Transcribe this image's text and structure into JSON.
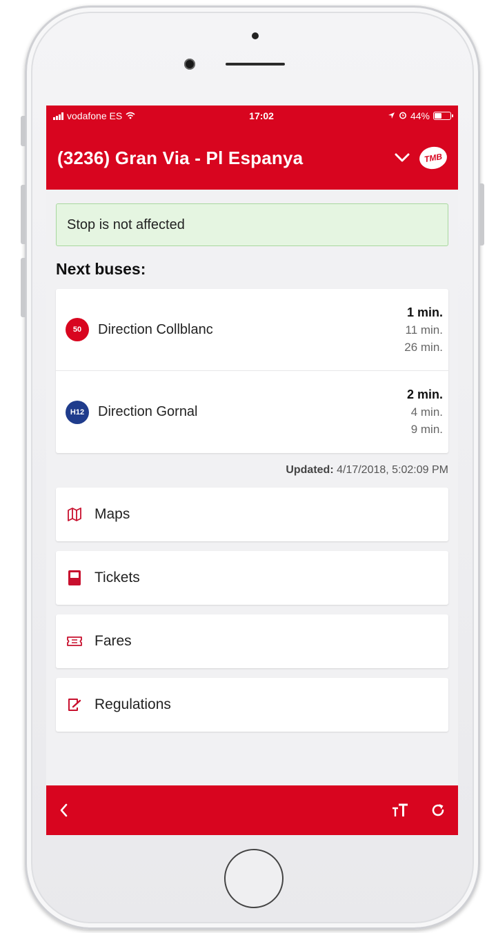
{
  "status_bar": {
    "carrier": "vodafone ES",
    "time": "17:02",
    "battery": "44%",
    "battery_level": 0.44
  },
  "header": {
    "title": "(3236) Gran Via - Pl Espanya",
    "logo_text": "TMB"
  },
  "alert": {
    "text": "Stop is not affected"
  },
  "next_buses": {
    "heading": "Next buses:",
    "rows": [
      {
        "line": "50",
        "line_color": "#d8051f",
        "direction": "Direction Collblanc",
        "times": [
          "1 min.",
          "11 min.",
          "26 min."
        ]
      },
      {
        "line": "H12",
        "line_color": "#1f3c8c",
        "direction": "Direction Gornal",
        "times": [
          "2 min.",
          "4 min.",
          "9 min."
        ]
      }
    ]
  },
  "updated": {
    "label": "Updated:",
    "value": "4/17/2018, 5:02:09 PM"
  },
  "menu": [
    {
      "label": "Maps",
      "icon": "map-icon"
    },
    {
      "label": "Tickets",
      "icon": "ticket-card-icon"
    },
    {
      "label": "Fares",
      "icon": "fare-ticket-icon"
    },
    {
      "label": "Regulations",
      "icon": "regulations-icon"
    }
  ],
  "bottom_bar": {
    "back_icon": "back-icon",
    "text_size_icon": "text-size-icon",
    "refresh_icon": "refresh-icon"
  },
  "colors": {
    "brand_red": "#d8051f",
    "alert_bg": "#e5f5e1",
    "alert_border": "#a8d79e",
    "h12_blue": "#1f3c8c"
  }
}
